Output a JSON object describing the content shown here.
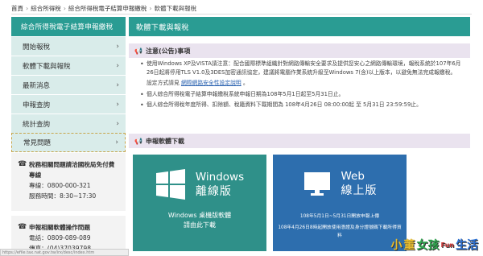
{
  "breadcrumb": [
    "首頁",
    "綜合所得稅",
    "綜合所得稅電子結算申報繳稅",
    "軟體下載與報稅"
  ],
  "sidebar": {
    "title": "綜合所得稅電子結算申報繳稅",
    "items": [
      {
        "label": "開始報稅"
      },
      {
        "label": "軟體下載與報稅"
      },
      {
        "label": "最新消息"
      },
      {
        "label": "申報查詢"
      },
      {
        "label": "統計查詢"
      },
      {
        "label": "常見問題"
      }
    ]
  },
  "contact1": {
    "title": "稅務相關問題請洽國稅局免付費專線",
    "line1": "專線：0800-000-321",
    "line2": "服務時間：8:30~17:30"
  },
  "contact2": {
    "title": "申報相關軟體操作問題",
    "line1": "電話：0809-089-089",
    "line2": "傳真：(04)37039798"
  },
  "main": {
    "title": "軟體下載與報稅",
    "notice_head": "注意(公告)事項",
    "notice1": "使用Windows XP及VISTA請注意：配合國際標準組織針對網路傳輸安全要求及提供您安心之網路傳輸環境，報稅系統於107年6月26日起將停用TLS V1.0及3DES加密通訊協定，建議將電腦作業系統升級至Windows 7(含)以上版本，以避免無法完成報繳稅。",
    "notice1_sub_prefix": "設定方式請見",
    "notice1_sub_link": "網際網路安全性設定說明",
    "notice1_sub_suffix": "。",
    "notice2": "個人綜合所得稅電子結算申報繳稅系統申報日期為108年5月1日起至5月31日止。",
    "notice3": "個人綜合所得稅年度所得、扣除額、稅籍資料下載期間為 108年4月26日 08:00:00起 至 5月31日 23:59:59止。",
    "download_head": "申報軟體下載"
  },
  "tiles": {
    "windows": {
      "title_en": "Windows",
      "title_zh": "離線版",
      "cap1": "Windows 桌機版軟體",
      "cap2": "請由此下載"
    },
    "web": {
      "title_en": "Web",
      "title_zh": "線上版",
      "cap1": "108年5月1日~5月31日開放申報上傳",
      "cap2": "108年4月26日8時起開放使用憑證及身分證號碼下載所得資料"
    }
  },
  "status_url": "https://efile.tax.nat.gov.tw/irx/desc/index.htm",
  "watermark": [
    "小",
    "董",
    "女孩",
    "Fun",
    "生活"
  ],
  "colors": {
    "teal": "#2a9c93",
    "tile_teal": "#2f9089",
    "tile_blue": "#2d6eae",
    "section_bg": "#eae3ef",
    "sidebar_item_bg": "#d9ecea"
  }
}
